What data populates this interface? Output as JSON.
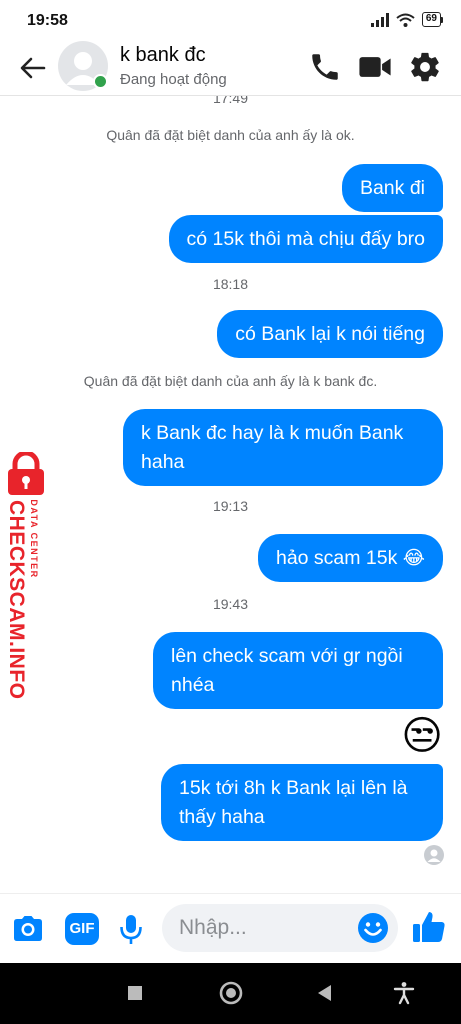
{
  "status_bar": {
    "time": "19:58",
    "battery": "69",
    "icons": [
      "signal-icon",
      "wifi-icon",
      "battery-icon"
    ]
  },
  "header": {
    "contact_name": "k bank đc",
    "contact_status": "Đang hoạt động",
    "icons": [
      "back-arrow-icon",
      "avatar-placeholder",
      "phone-icon",
      "video-call-icon",
      "gear-icon"
    ],
    "colors": {
      "online": "#31a24c"
    }
  },
  "chat": {
    "bubble_color": "#0084ff",
    "items": [
      {
        "kind": "timestamp",
        "text": "17:49"
      },
      {
        "kind": "system",
        "text": "Quân đã đặt biệt danh của anh ấy là ok."
      },
      {
        "kind": "outgoing",
        "text": "Bank đi"
      },
      {
        "kind": "outgoing",
        "text": "có 15k thôi mà chịu đấy bro"
      },
      {
        "kind": "timestamp",
        "text": "18:18"
      },
      {
        "kind": "outgoing",
        "text": "có Bank lại k nói tiếng"
      },
      {
        "kind": "system",
        "text": "Quân đã đặt biệt danh của anh ấy là k bank đc."
      },
      {
        "kind": "outgoing",
        "lines": [
          "k Bank đc hay là k muốn Bank",
          "haha"
        ]
      },
      {
        "kind": "timestamp",
        "text": "19:13"
      },
      {
        "kind": "outgoing",
        "text": "hảo scam 15k",
        "emoji": "😂"
      },
      {
        "kind": "timestamp",
        "text": "19:43"
      },
      {
        "kind": "outgoing",
        "lines": [
          "lên check scam với gr ngồi",
          "nhéa"
        ]
      },
      {
        "kind": "emoji",
        "emoji": "😒"
      },
      {
        "kind": "outgoing",
        "lines": [
          "15k tới 8h k Bank lại lên là",
          "thấy haha"
        ]
      },
      {
        "kind": "seen",
        "icon": "seen-avatar-icon"
      }
    ]
  },
  "watermark": {
    "site": "CHECKSCAM.INFO",
    "tagline": "DATA CENTER",
    "icon": "lock-icon",
    "color": "#e8242b"
  },
  "composer": {
    "placeholder": "Nhập...",
    "icons": [
      "camera-icon",
      "gif-icon",
      "microphone-icon",
      "emoji-icon",
      "thumbs-up-icon"
    ],
    "gif_label": "GIF",
    "accent": "#0084ff"
  },
  "navbar": {
    "icons": [
      "recents-icon",
      "home-icon",
      "back-icon",
      "accessibility-icon"
    ]
  }
}
